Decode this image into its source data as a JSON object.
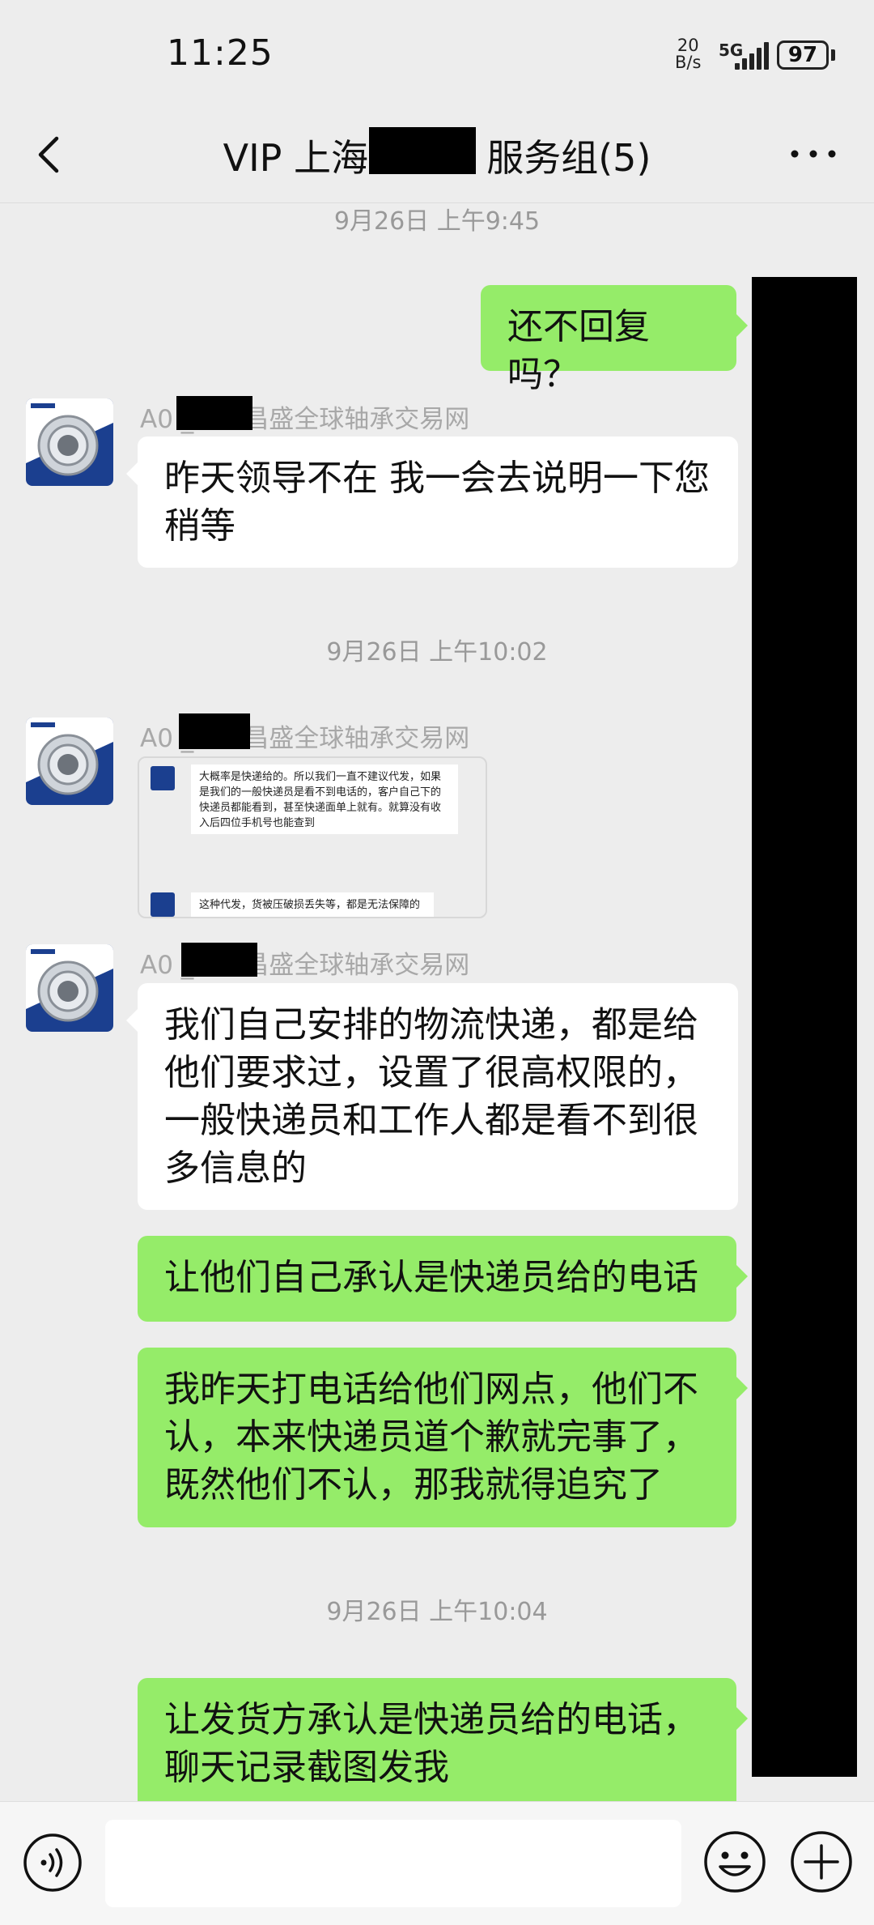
{
  "status_bar": {
    "time": "11:25",
    "net_speed_value": "20",
    "net_speed_unit": "B/s",
    "network": "5G",
    "battery": "97"
  },
  "header": {
    "title": "VIP 上海          服务组(5)",
    "back_icon": "chevron-left-icon",
    "more_icon": "more-dots-icon"
  },
  "messages": {
    "ts1": "9月26日 上午9:45",
    "out1": "还不回复吗？",
    "sender_name": "A0          _中机昌盛全球轴承交易网",
    "in1": "昨天领导不在 我一会去说明一下您稍等",
    "ts2": "9月26日 上午10:02",
    "image_quote1": "大概率是快递给的。所以我们一直不建议代发，如果是我们的一般快递员是看不到电话的，客户自己下的快递员都能看到，甚至快递面单上就有。就算没有收入后四位手机号也能查到",
    "image_quote2": "这种代发，货被压破损丢失等，都是无法保障的",
    "in2": "我们自己安排的物流快递，都是给他们要求过，设置了很高权限的，一般快递员和工作人都是看不到很多信息的",
    "out2": "让他们自己承认是快递员给的电话",
    "out3": "我昨天打电话给他们网点，他们不认，本来快递员道个歉就完事了，既然他们不认，那我就得追究了",
    "ts3": "9月26日 上午10:04",
    "out4": "让发货方承认是快递员给的电话，聊天记录截图发我"
  },
  "input_bar": {
    "voice_icon": "voice-icon",
    "text_value": "",
    "emoji_icon": "emoji-icon",
    "plus_icon": "plus-icon"
  },
  "colors": {
    "background": "#ededed",
    "out_bubble": "#95ec69",
    "in_bubble": "#ffffff",
    "timestamp": "#999999",
    "sender": "#a8a8a8"
  }
}
